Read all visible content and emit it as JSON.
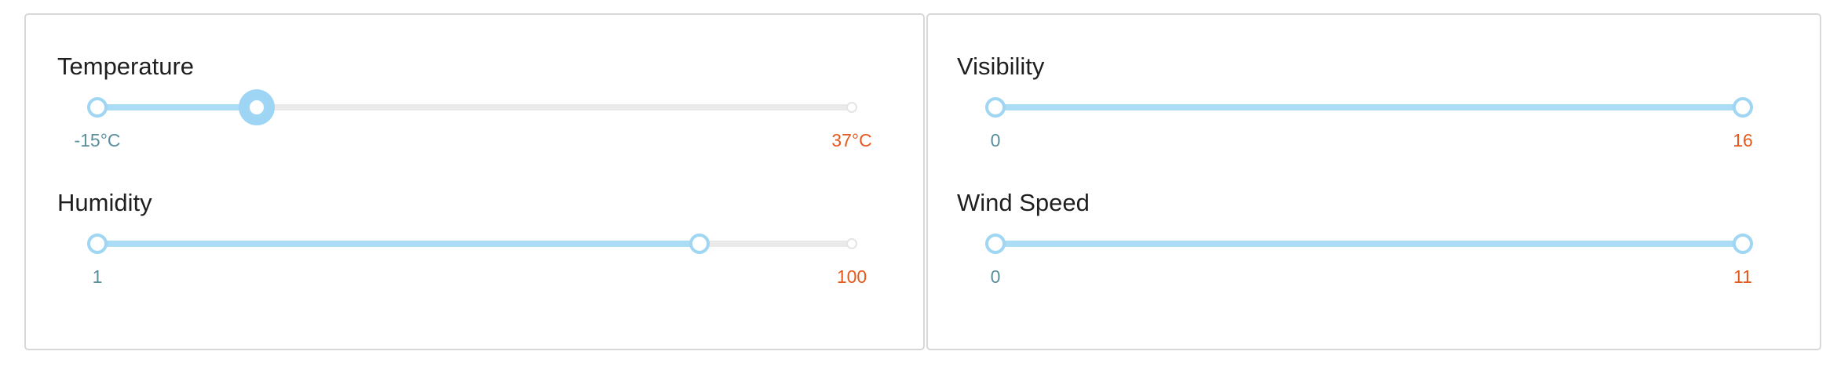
{
  "sliders": [
    {
      "label": "Temperature",
      "min_label": "-15°C",
      "max_label": "37°C",
      "min": -15,
      "max": 37,
      "range_low": -15,
      "range_high": -4
    },
    {
      "label": "Humidity",
      "min_label": "1",
      "max_label": "100",
      "min": 1,
      "max": 100,
      "range_low": 1,
      "range_high": 80
    },
    {
      "label": "Visibility",
      "min_label": "0",
      "max_label": "16",
      "min": 0,
      "max": 16,
      "range_low": 0,
      "range_high": 16
    },
    {
      "label": "Wind Speed",
      "min_label": "0",
      "max_label": "11",
      "min": 0,
      "max": 11,
      "range_low": 0,
      "range_high": 11
    }
  ],
  "colors": {
    "track_fill": "#abdcf5",
    "track_empty": "#eaeaea",
    "handle_border": "#9fd6f3",
    "min_label": "#5a8f9e",
    "max_label": "#e45a1e"
  }
}
